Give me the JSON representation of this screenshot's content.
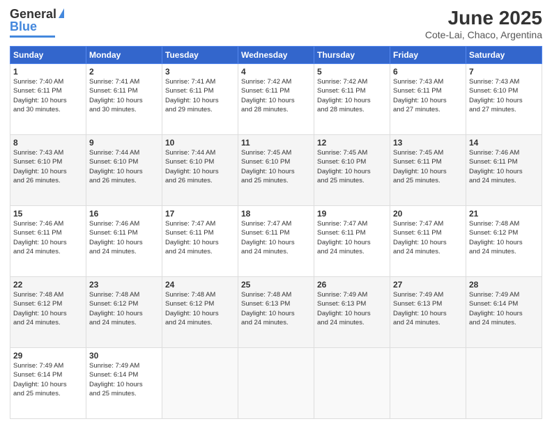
{
  "header": {
    "logo_general": "General",
    "logo_blue": "Blue",
    "title": "June 2025",
    "subtitle": "Cote-Lai, Chaco, Argentina"
  },
  "columns": [
    "Sunday",
    "Monday",
    "Tuesday",
    "Wednesday",
    "Thursday",
    "Friday",
    "Saturday"
  ],
  "rows": [
    [
      {
        "day": "1",
        "info": "Sunrise: 7:40 AM\nSunset: 6:11 PM\nDaylight: 10 hours\nand 30 minutes."
      },
      {
        "day": "2",
        "info": "Sunrise: 7:41 AM\nSunset: 6:11 PM\nDaylight: 10 hours\nand 30 minutes."
      },
      {
        "day": "3",
        "info": "Sunrise: 7:41 AM\nSunset: 6:11 PM\nDaylight: 10 hours\nand 29 minutes."
      },
      {
        "day": "4",
        "info": "Sunrise: 7:42 AM\nSunset: 6:11 PM\nDaylight: 10 hours\nand 28 minutes."
      },
      {
        "day": "5",
        "info": "Sunrise: 7:42 AM\nSunset: 6:11 PM\nDaylight: 10 hours\nand 28 minutes."
      },
      {
        "day": "6",
        "info": "Sunrise: 7:43 AM\nSunset: 6:11 PM\nDaylight: 10 hours\nand 27 minutes."
      },
      {
        "day": "7",
        "info": "Sunrise: 7:43 AM\nSunset: 6:10 PM\nDaylight: 10 hours\nand 27 minutes."
      }
    ],
    [
      {
        "day": "8",
        "info": "Sunrise: 7:43 AM\nSunset: 6:10 PM\nDaylight: 10 hours\nand 26 minutes."
      },
      {
        "day": "9",
        "info": "Sunrise: 7:44 AM\nSunset: 6:10 PM\nDaylight: 10 hours\nand 26 minutes."
      },
      {
        "day": "10",
        "info": "Sunrise: 7:44 AM\nSunset: 6:10 PM\nDaylight: 10 hours\nand 26 minutes."
      },
      {
        "day": "11",
        "info": "Sunrise: 7:45 AM\nSunset: 6:10 PM\nDaylight: 10 hours\nand 25 minutes."
      },
      {
        "day": "12",
        "info": "Sunrise: 7:45 AM\nSunset: 6:10 PM\nDaylight: 10 hours\nand 25 minutes."
      },
      {
        "day": "13",
        "info": "Sunrise: 7:45 AM\nSunset: 6:11 PM\nDaylight: 10 hours\nand 25 minutes."
      },
      {
        "day": "14",
        "info": "Sunrise: 7:46 AM\nSunset: 6:11 PM\nDaylight: 10 hours\nand 24 minutes."
      }
    ],
    [
      {
        "day": "15",
        "info": "Sunrise: 7:46 AM\nSunset: 6:11 PM\nDaylight: 10 hours\nand 24 minutes."
      },
      {
        "day": "16",
        "info": "Sunrise: 7:46 AM\nSunset: 6:11 PM\nDaylight: 10 hours\nand 24 minutes."
      },
      {
        "day": "17",
        "info": "Sunrise: 7:47 AM\nSunset: 6:11 PM\nDaylight: 10 hours\nand 24 minutes."
      },
      {
        "day": "18",
        "info": "Sunrise: 7:47 AM\nSunset: 6:11 PM\nDaylight: 10 hours\nand 24 minutes."
      },
      {
        "day": "19",
        "info": "Sunrise: 7:47 AM\nSunset: 6:11 PM\nDaylight: 10 hours\nand 24 minutes."
      },
      {
        "day": "20",
        "info": "Sunrise: 7:47 AM\nSunset: 6:11 PM\nDaylight: 10 hours\nand 24 minutes."
      },
      {
        "day": "21",
        "info": "Sunrise: 7:48 AM\nSunset: 6:12 PM\nDaylight: 10 hours\nand 24 minutes."
      }
    ],
    [
      {
        "day": "22",
        "info": "Sunrise: 7:48 AM\nSunset: 6:12 PM\nDaylight: 10 hours\nand 24 minutes."
      },
      {
        "day": "23",
        "info": "Sunrise: 7:48 AM\nSunset: 6:12 PM\nDaylight: 10 hours\nand 24 minutes."
      },
      {
        "day": "24",
        "info": "Sunrise: 7:48 AM\nSunset: 6:12 PM\nDaylight: 10 hours\nand 24 minutes."
      },
      {
        "day": "25",
        "info": "Sunrise: 7:48 AM\nSunset: 6:13 PM\nDaylight: 10 hours\nand 24 minutes."
      },
      {
        "day": "26",
        "info": "Sunrise: 7:49 AM\nSunset: 6:13 PM\nDaylight: 10 hours\nand 24 minutes."
      },
      {
        "day": "27",
        "info": "Sunrise: 7:49 AM\nSunset: 6:13 PM\nDaylight: 10 hours\nand 24 minutes."
      },
      {
        "day": "28",
        "info": "Sunrise: 7:49 AM\nSunset: 6:14 PM\nDaylight: 10 hours\nand 24 minutes."
      }
    ],
    [
      {
        "day": "29",
        "info": "Sunrise: 7:49 AM\nSunset: 6:14 PM\nDaylight: 10 hours\nand 25 minutes."
      },
      {
        "day": "30",
        "info": "Sunrise: 7:49 AM\nSunset: 6:14 PM\nDaylight: 10 hours\nand 25 minutes."
      },
      {
        "day": "",
        "info": ""
      },
      {
        "day": "",
        "info": ""
      },
      {
        "day": "",
        "info": ""
      },
      {
        "day": "",
        "info": ""
      },
      {
        "day": "",
        "info": ""
      }
    ]
  ]
}
